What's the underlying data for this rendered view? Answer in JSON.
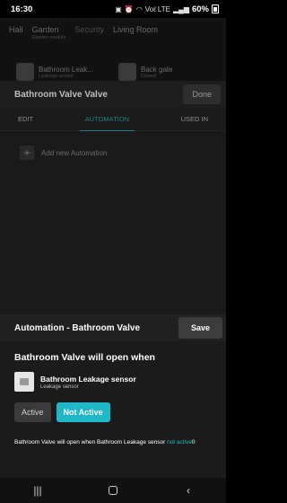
{
  "status_bar": {
    "time": "16:30",
    "battery": "60%",
    "network_label": "Voℓ LTE"
  },
  "background": {
    "room_tabs": [
      {
        "label": "Hall",
        "sub": ""
      },
      {
        "label": "Garden",
        "sub": "Garden module"
      },
      {
        "label": "Security",
        "sub": ""
      },
      {
        "label": "Living Room",
        "sub": ""
      }
    ],
    "devices": [
      {
        "name": "Bathroom Leak...",
        "sub": "Leakage sensor"
      },
      {
        "name": "Back gate",
        "sub": "Closed"
      }
    ]
  },
  "device_panel": {
    "title": "Bathroom Valve Valve",
    "done_label": "Done",
    "tabs": [
      "EDIT",
      "AUTOMATION",
      "USED IN"
    ],
    "add_automation_label": "Add new Automation"
  },
  "sheet": {
    "title": "Automation - Bathroom Valve",
    "save_label": "Save",
    "will_open_text": "Bathroom Valve will open when",
    "sensor": {
      "name": "Bathroom Leakage sensor",
      "type": "Leakage sensor"
    },
    "state_options": [
      "Active",
      "Not Active"
    ],
    "selected_state": "Not Active",
    "summary_prefix": "Bathroom Valve will open when Bathroom Leakage sensor",
    "summary_highlight_1": "not",
    "summary_highlight_2": "active",
    "summary_suffix": "0"
  },
  "colors": {
    "accent": "#1fb8c9",
    "accent_dim": "#1f7f8a"
  }
}
